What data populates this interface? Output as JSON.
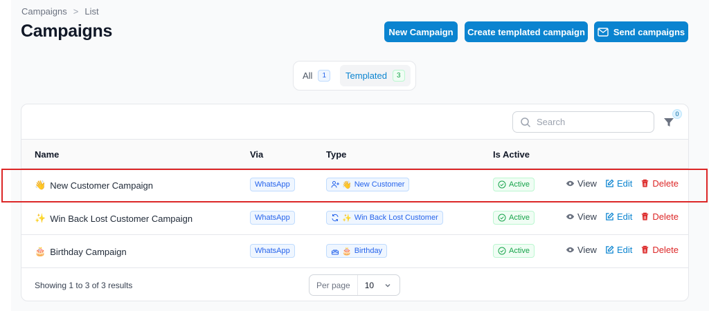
{
  "breadcrumb": {
    "parent": "Campaigns",
    "current": "List"
  },
  "page_title": "Campaigns",
  "actions": {
    "new_campaign": "New Campaign",
    "create_templated": "Create templated campaign",
    "send_campaigns": "Send campaigns"
  },
  "tabs": [
    {
      "label": "All",
      "count": "1"
    },
    {
      "label": "Templated",
      "count": "3"
    }
  ],
  "search": {
    "placeholder": "Search"
  },
  "filter": {
    "count": "0"
  },
  "table": {
    "columns": {
      "name": "Name",
      "via": "Via",
      "type": "Type",
      "is_active": "Is Active"
    },
    "rows": [
      {
        "emoji": "👋",
        "name": "New Customer Campaign",
        "via": "WhatsApp",
        "type_emoji": "👋",
        "type": "New Customer",
        "status": "Active"
      },
      {
        "emoji": "✨",
        "name": "Win Back Lost Customer Campaign",
        "via": "WhatsApp",
        "type_emoji": "✨",
        "type": "Win Back Lost Customer",
        "status": "Active"
      },
      {
        "emoji": "🎂",
        "name": "Birthday Campaign",
        "via": "WhatsApp",
        "type_emoji": "🎂",
        "type": "Birthday",
        "status": "Active"
      }
    ],
    "row_actions": {
      "view": "View",
      "edit": "Edit",
      "delete": "Delete"
    }
  },
  "footer": {
    "summary": "Showing 1 to 3 of 3 results",
    "per_page_label": "Per page",
    "per_page_value": "10"
  },
  "colors": {
    "accent": "#0b84d0",
    "danger": "#dc2626",
    "success": "#16a34a",
    "highlight": "#dc2626"
  }
}
